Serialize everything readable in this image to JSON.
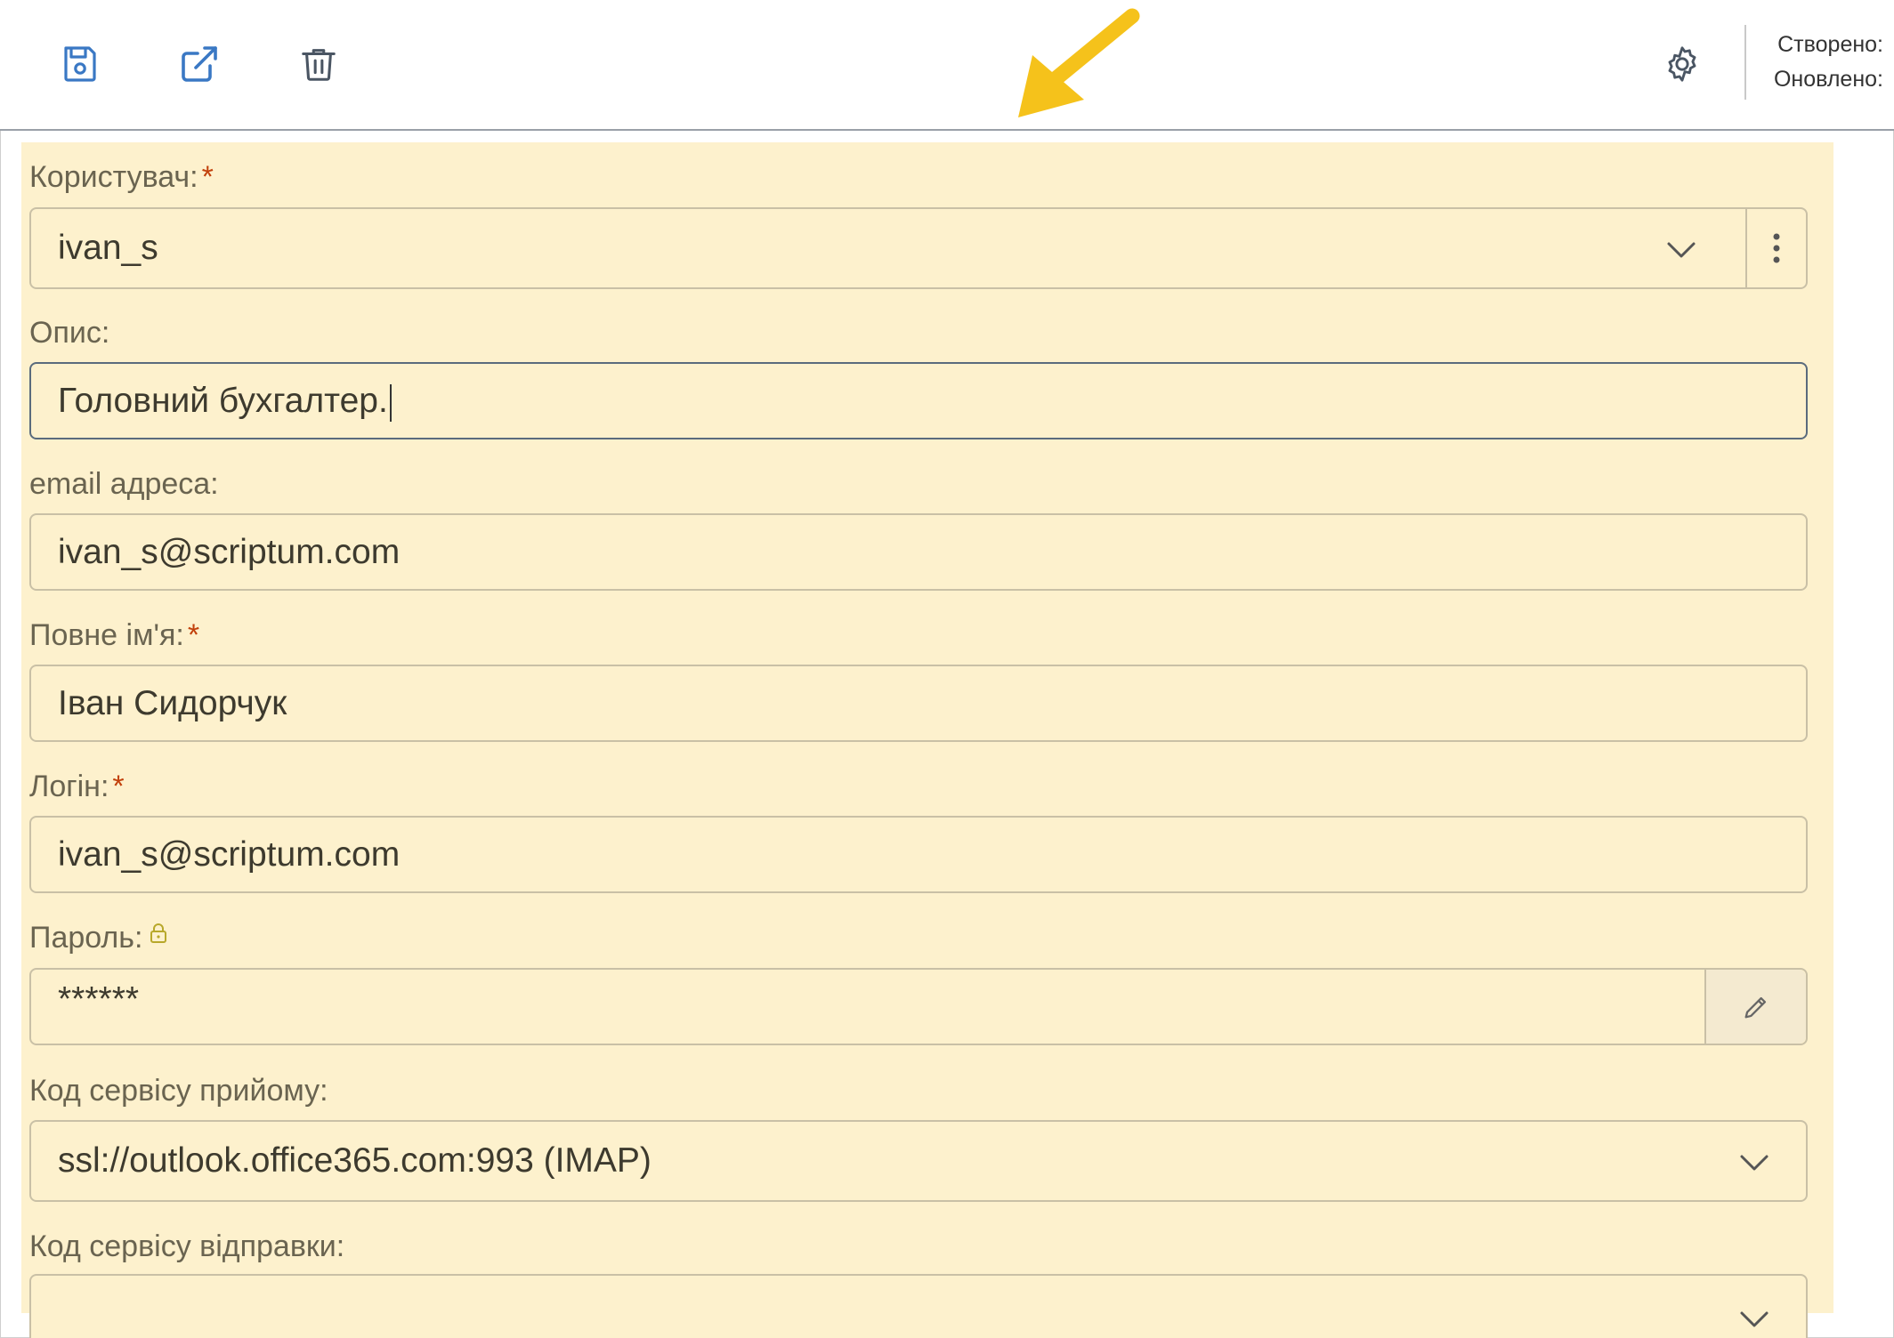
{
  "toolbar": {
    "icons": [
      "save-icon",
      "open-external-icon",
      "trash-icon",
      "gear-icon"
    ],
    "created_label": "Створено:",
    "updated_label": "Оновлено:"
  },
  "form": {
    "user": {
      "label": "Користувач:",
      "required_mark": "*",
      "value": "ivan_s"
    },
    "description": {
      "label": "Опис:",
      "value": "Головний бухгалтер."
    },
    "email": {
      "label": "email адреса:",
      "value": "ivan_s@scriptum.com"
    },
    "full_name": {
      "label": "Повне ім'я:",
      "required_mark": "*",
      "value": "Іван Сидорчук"
    },
    "login": {
      "label": "Логін:",
      "required_mark": "*",
      "value": "ivan_s@scriptum.com"
    },
    "password": {
      "label": "Пароль:",
      "value": "******"
    },
    "receive_service": {
      "label": "Код сервісу прийому:",
      "value": "ssl://outlook.office365.com:993 (IMAP)"
    },
    "send_service": {
      "label": "Код сервісу відправки:",
      "value": ""
    }
  },
  "colors": {
    "highlight": "#fdf1cd",
    "accent_icon": "#3a78c4",
    "arrow": "#f5c21b",
    "required": "#c2410c"
  }
}
